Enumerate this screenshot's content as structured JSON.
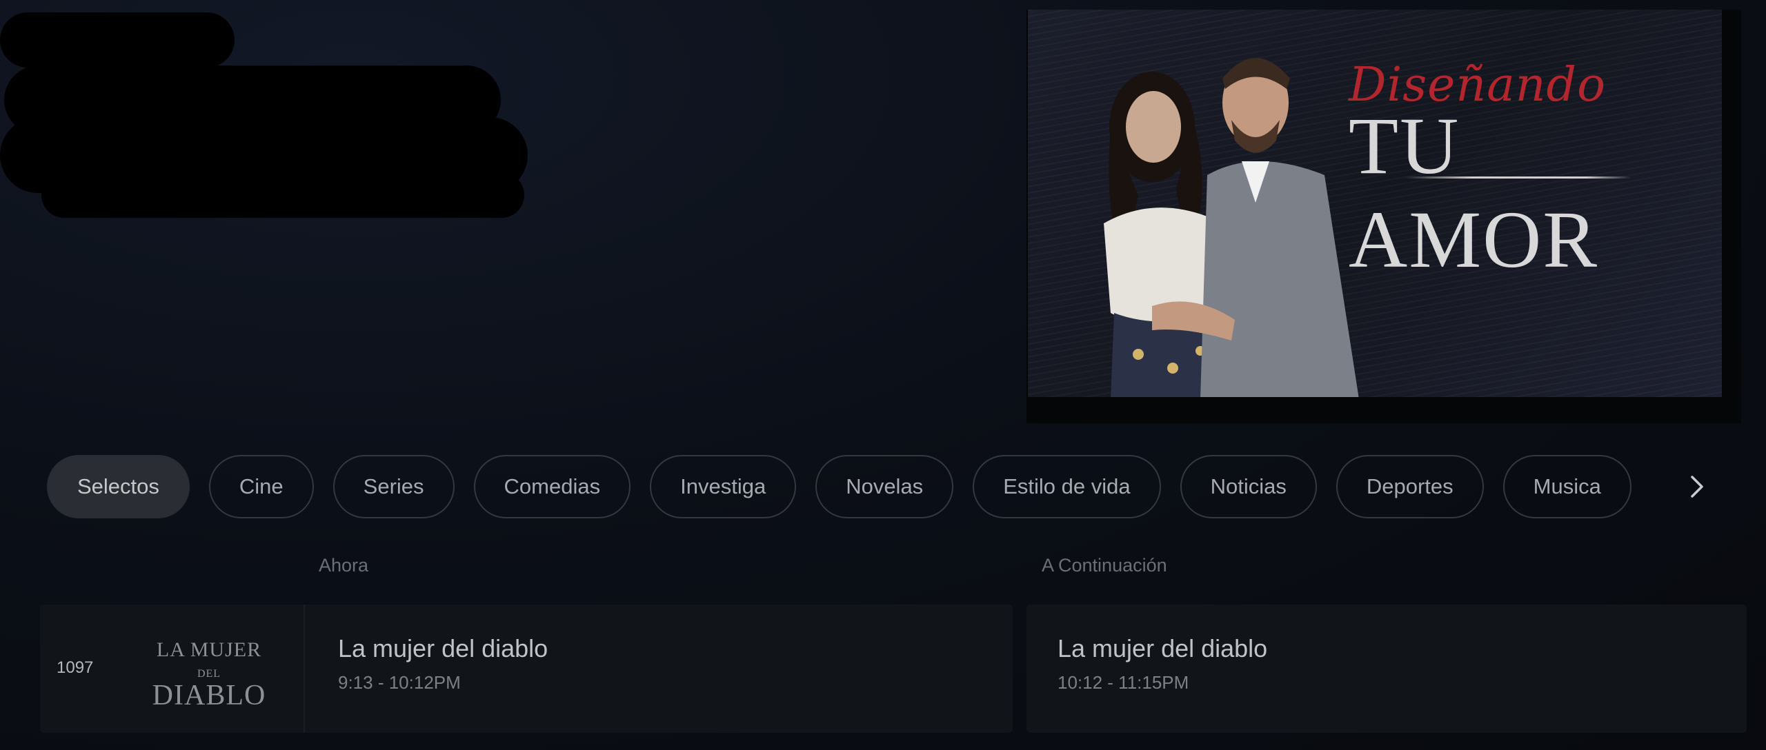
{
  "hero": {
    "title_script": "Diseñando",
    "title_main": "TU AMOR"
  },
  "tabs": [
    {
      "label": "Selectos",
      "active": true
    },
    {
      "label": "Cine",
      "active": false
    },
    {
      "label": "Series",
      "active": false
    },
    {
      "label": "Comedias",
      "active": false
    },
    {
      "label": "Investiga",
      "active": false
    },
    {
      "label": "Novelas",
      "active": false
    },
    {
      "label": "Estilo de vida",
      "active": false
    },
    {
      "label": "Noticias",
      "active": false
    },
    {
      "label": "Deportes",
      "active": false
    },
    {
      "label": "Musica",
      "active": false
    }
  ],
  "tabs_scroll_icon": "chevron-right-icon",
  "guide": {
    "now_label": "Ahora",
    "next_label": "A Continuación",
    "channel": {
      "number": "1097",
      "logo_top": "LA MUJER",
      "logo_top_small": "DEL",
      "logo_bottom": "DIABLO"
    },
    "now": {
      "title": "La mujer del diablo",
      "time": "9:13  -  10:12PM"
    },
    "next": {
      "title": "La mujer del diablo",
      "time": "10:12  -  11:15PM"
    }
  }
}
